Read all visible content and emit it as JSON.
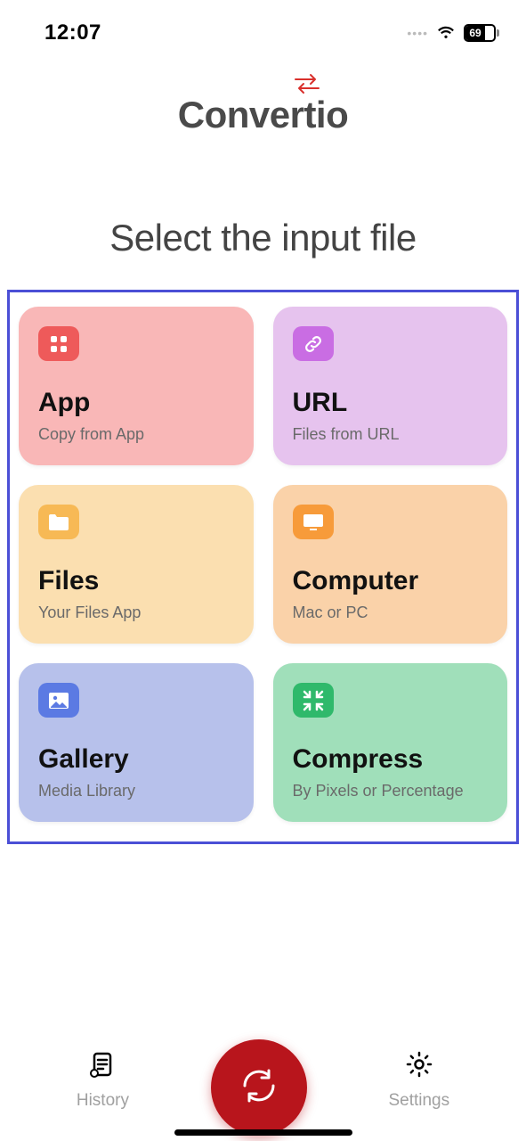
{
  "status": {
    "time": "12:07",
    "battery": "69"
  },
  "logo": {
    "text": "Convertio"
  },
  "title": "Select the input file",
  "cards": {
    "app": {
      "title": "App",
      "sub": "Copy from App"
    },
    "url": {
      "title": "URL",
      "sub": "Files from URL"
    },
    "files": {
      "title": "Files",
      "sub": "Your Files App"
    },
    "computer": {
      "title": "Computer",
      "sub": "Mac or PC"
    },
    "gallery": {
      "title": "Gallery",
      "sub": "Media Library"
    },
    "compress": {
      "title": "Compress",
      "sub": "By Pixels or Percentage"
    }
  },
  "tabs": {
    "history": "History",
    "settings": "Settings"
  }
}
